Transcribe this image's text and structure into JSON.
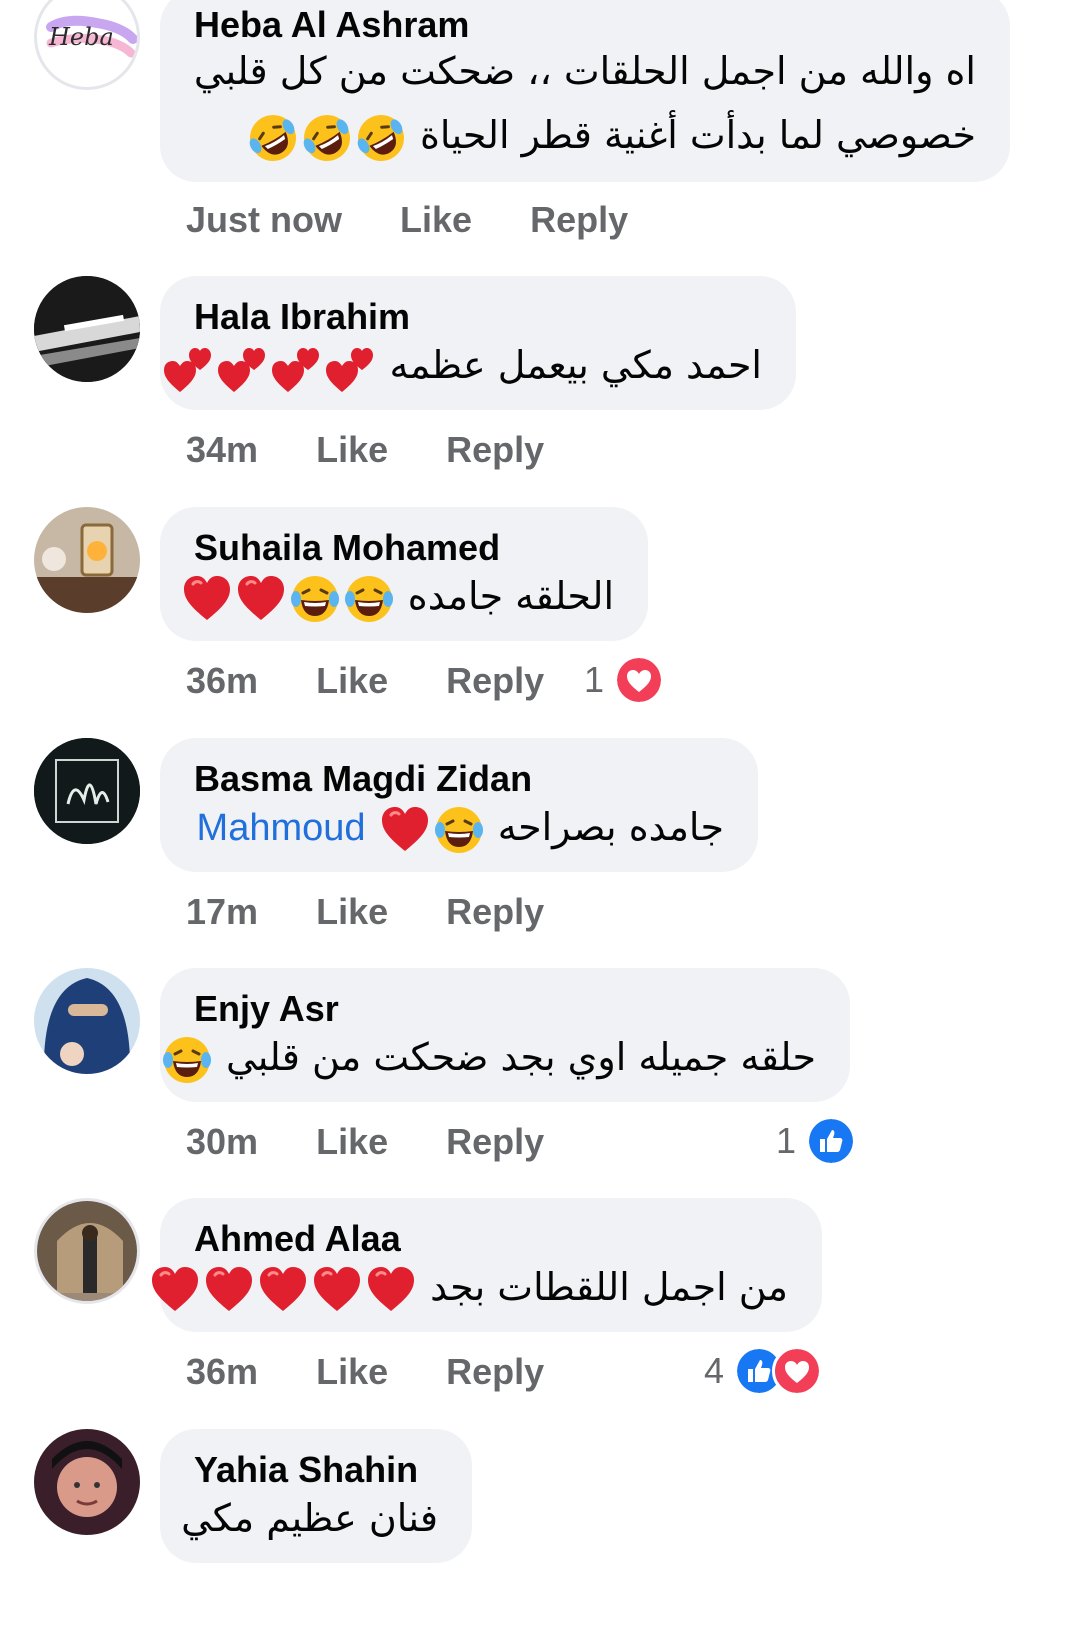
{
  "labels": {
    "like": "Like",
    "reply": "Reply"
  },
  "colors": {
    "bubble": "#f0f2f5",
    "meta": "#65676b",
    "mention": "#216fdb",
    "like_blue": "#1877f2",
    "love_red": "#f33e58"
  },
  "comments": [
    {
      "author": "Heba Al Ashram",
      "avatar_text": "Heba",
      "line1": "اه والله من اجمل الحلقات ،، ضحكت من كل قلبي",
      "line2": "خصوصي لما بدأت أغنية قطر الحياة",
      "emojis": [
        "rolling-laughing",
        "rolling-laughing",
        "rolling-laughing"
      ],
      "time": "Just now"
    },
    {
      "author": "Hala Ibrahim",
      "text": "احمد مكي بيعمل عظمه",
      "emojis": [
        "two-hearts",
        "two-hearts",
        "two-hearts",
        "two-hearts"
      ],
      "time": "34m"
    },
    {
      "author": "Suhaila Mohamed",
      "text": "الحلقه جامده",
      "emojis": [
        "laughing-tears",
        "laughing-tears",
        "red-heart",
        "red-heart"
      ],
      "time": "36m",
      "reactions": {
        "count": "1",
        "types": [
          "love"
        ]
      }
    },
    {
      "author": "Basma Magdi Zidan",
      "text": "جامده بصراحه",
      "mention": "Mahmoud",
      "emojis": [
        "laughing-tears",
        "red-heart"
      ],
      "time": "17m"
    },
    {
      "author": "Enjy Asr",
      "text": "حلقه جميله اوي بجد ضحكت من قلبي",
      "emojis": [
        "laughing-tears"
      ],
      "time": "30m",
      "reactions": {
        "count": "1",
        "types": [
          "like"
        ]
      }
    },
    {
      "author": "Ahmed Alaa",
      "text": "من اجمل اللقطات بجد",
      "emojis": [
        "red-heart",
        "red-heart",
        "red-heart",
        "red-heart",
        "red-heart"
      ],
      "time": "36m",
      "reactions": {
        "count": "4",
        "types": [
          "like",
          "love"
        ]
      }
    },
    {
      "author": "Yahia Shahin",
      "text": "فنان عظيم مكي",
      "emojis": []
    }
  ]
}
